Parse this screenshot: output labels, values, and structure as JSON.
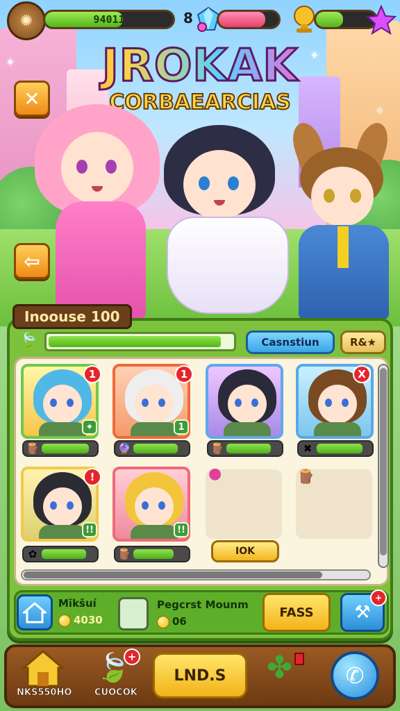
{
  "topbar": {
    "resource1": {
      "icon": "wood-coin-icon",
      "value": "94011",
      "progress": 0.61
    },
    "resource2": {
      "icon": "gem-icon",
      "prefix": "8",
      "progress": 0.78
    },
    "resource3": {
      "icon": "trophy-icon",
      "progress": 0.45,
      "star_icon": "star-icon"
    }
  },
  "title": {
    "main": "JROKAK",
    "sub": "CORBAEARCIAS"
  },
  "left_buttons": {
    "close_icon": "close-icon",
    "back_icon": "arrow-left-icon"
  },
  "panel": {
    "tag": "Inoouse 100",
    "progress": 0.94,
    "action_button": "Casnstiun",
    "rate_button": "R&★",
    "cards": [
      {
        "badge": "1",
        "mini": "✦",
        "bar_icon": "wood-icon",
        "bar_progress": 0.85,
        "hair": "#4fb8e6",
        "frame": "#6fc84a"
      },
      {
        "badge": "1",
        "mini": "1",
        "bar_icon": "orb-icon",
        "bar_progress": 0.8,
        "hair": "#eeeeee",
        "frame": "#ee6a3a"
      },
      {
        "badge": "",
        "mini": "",
        "bar_icon": "wood-icon",
        "bar_progress": 0.8,
        "hair": "#2a2a3a",
        "frame": "#5fa8ee"
      },
      {
        "badge": "X",
        "mini": "",
        "bar_icon": "leaf-x-icon",
        "bar_progress": 0.82,
        "hair": "#7a4a22",
        "frame": "#5aa8e6"
      },
      {
        "badge": "!",
        "mini": "!!",
        "bar_icon": "flower-icon",
        "bar_progress": 0.8,
        "hair": "#2b2b33",
        "frame": "#f2c94c"
      },
      {
        "badge": "",
        "mini": "!!",
        "bar_icon": "wood-icon",
        "bar_progress": 0.73,
        "hair": "#f3c53a",
        "frame": "#ee6a7a"
      }
    ],
    "empty_slots": [
      {
        "icon": "pink-creature-icon"
      },
      {
        "icon": "wood-bundle-icon"
      }
    ],
    "slot_button": "IOK",
    "info": {
      "home_icon": "house-icon",
      "name": "Mĭkšuı́",
      "coins": "4030",
      "card_icon": "id-card-icon",
      "desc": "Pegcrst Mounm",
      "desc_value": "06",
      "pass_button": "FASS",
      "tools_icon": "tools-icon"
    }
  },
  "bottom_nav": {
    "home_label": "NKS550HO",
    "leaf_label": "CUOCOK",
    "center_button": "LND.S",
    "call_icon": "phone-icon"
  }
}
